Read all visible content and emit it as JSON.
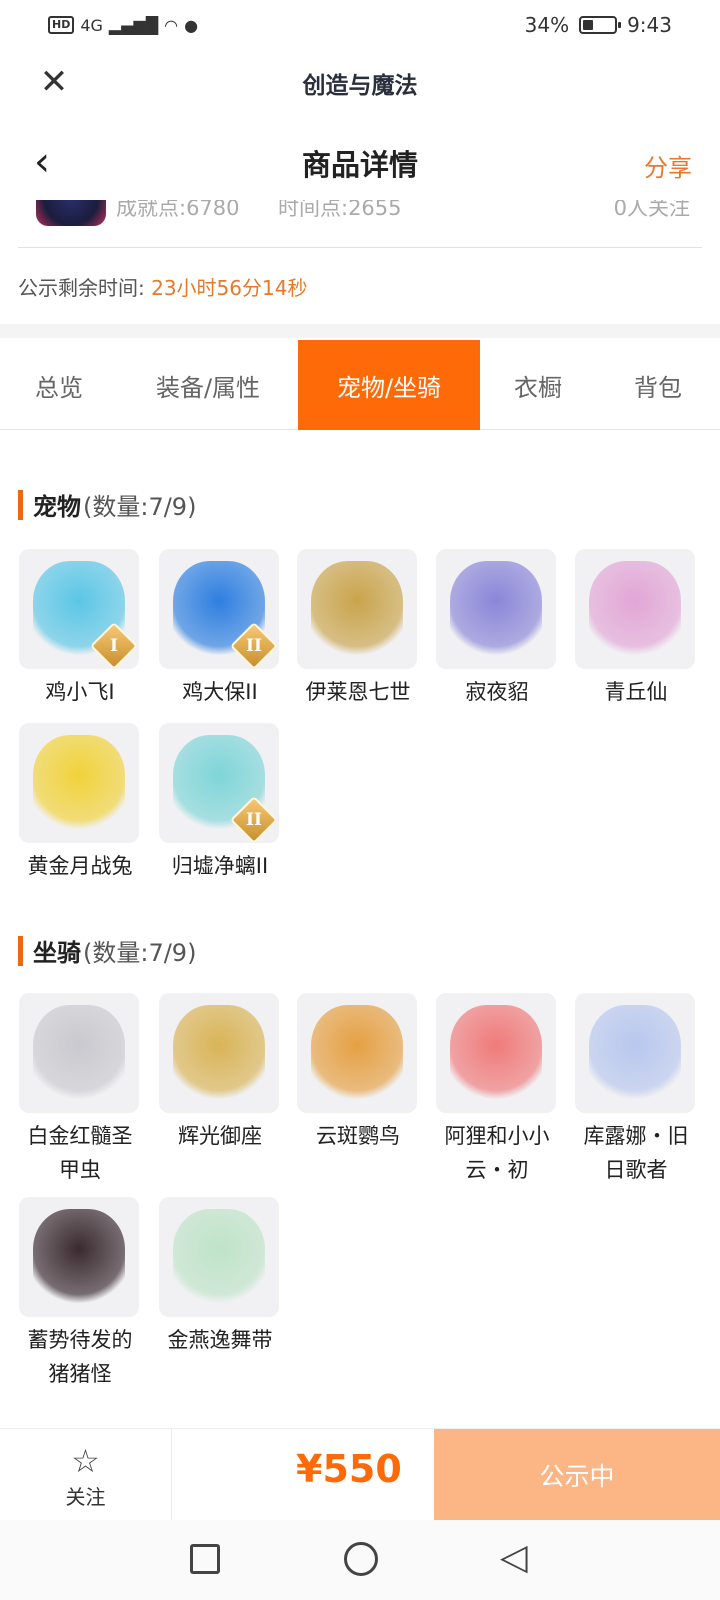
{
  "status_bar": {
    "hd": "HD",
    "network": "4G",
    "battery": "34%",
    "battery_level": 0.34,
    "time": "9:43"
  },
  "app": {
    "title": "创造与魔法",
    "close_icon": "close-icon"
  },
  "nav": {
    "title": "商品详情",
    "share": "分享",
    "back_icon": "back-chevron-icon"
  },
  "profile_stats": {
    "achievement": "成就点:6780",
    "time_points": "时间点:2655",
    "followers": "0人关注"
  },
  "countdown": {
    "label": "公示剩余时间:",
    "value": "23小时56分14秒"
  },
  "tabs": [
    {
      "label": "总览",
      "active": false
    },
    {
      "label": "装备/属性",
      "active": false
    },
    {
      "label": "宠物/坐骑",
      "active": true
    },
    {
      "label": "衣橱",
      "active": false
    },
    {
      "label": "背包",
      "active": false
    }
  ],
  "pets": {
    "title": "宠物",
    "count": "(数量:7/9)",
    "items": [
      {
        "name": "鸡小飞I",
        "badge": "I",
        "color": "#5bc6e6"
      },
      {
        "name": "鸡大保II",
        "badge": "II",
        "color": "#2e7fe0"
      },
      {
        "name": "伊莱恩七世",
        "badge": "",
        "color": "#c9a44c"
      },
      {
        "name": "寂夜貂",
        "badge": "",
        "color": "#8b86d8"
      },
      {
        "name": "青丘仙",
        "badge": "",
        "color": "#e2a6d6"
      },
      {
        "name": "黄金月战兔",
        "badge": "",
        "color": "#f1d23a"
      },
      {
        "name": "归墟净螭II",
        "badge": "II",
        "color": "#7fd5d8"
      }
    ]
  },
  "mounts": {
    "title": "坐骑",
    "count": "(数量:7/9)",
    "items": [
      {
        "name": "白金红髓圣甲虫",
        "badge": "",
        "color": "#c9c9cf"
      },
      {
        "name": "辉光御座",
        "badge": "",
        "color": "#d9b457"
      },
      {
        "name": "云斑鹦鸟",
        "badge": "",
        "color": "#e5a043"
      },
      {
        "name": "阿狸和小小云・初",
        "badge": "",
        "color": "#f07a7a"
      },
      {
        "name": "库露娜・旧日歌者",
        "badge": "",
        "color": "#b8c7ee"
      },
      {
        "name": "蓄势待发的猪猪怪",
        "badge": "",
        "color": "#3a2a30"
      },
      {
        "name": "金燕逸舞带",
        "badge": "",
        "color": "#bfe3c8"
      }
    ]
  },
  "bottom": {
    "follow_label": "关注",
    "star_icon": "star-outline-icon",
    "price": "¥550",
    "status_button": "公示中"
  },
  "system_nav": {
    "recent_icon": "square-icon",
    "home_icon": "circle-icon",
    "back_icon": "triangle-back-icon"
  }
}
